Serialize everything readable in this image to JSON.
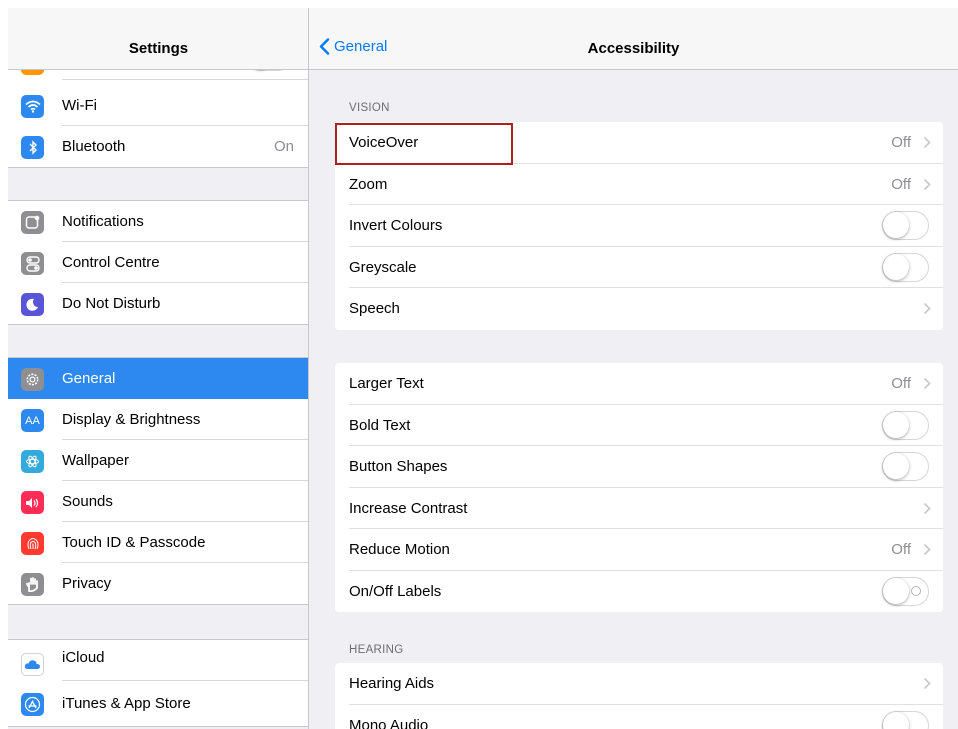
{
  "left_pane": {
    "title": "Settings",
    "groups": [
      {
        "items": [
          {
            "label": "Wi-Fi",
            "icon": "wifi-icon",
            "color": "#2d89ef"
          },
          {
            "label": "Bluetooth",
            "icon": "bluetooth-icon",
            "color": "#2d89ef",
            "value": "On"
          }
        ]
      },
      {
        "items": [
          {
            "label": "Notifications",
            "icon": "notifications-icon",
            "color": "#8e8e93"
          },
          {
            "label": "Control Centre",
            "icon": "control-centre-icon",
            "color": "#8e8e93"
          },
          {
            "label": "Do Not Disturb",
            "icon": "moon-icon",
            "color": "#5856d6"
          }
        ]
      },
      {
        "items": [
          {
            "label": "General",
            "icon": "gear-icon",
            "color": "#8e8e93",
            "selected": true
          },
          {
            "label": "Display & Brightness",
            "icon": "display-icon",
            "color": "#2d89ef",
            "glyph": "AA"
          },
          {
            "label": "Wallpaper",
            "icon": "wallpaper-icon",
            "color": "#34aadc"
          },
          {
            "label": "Sounds",
            "icon": "sounds-icon",
            "color": "#ff2d55"
          },
          {
            "label": "Touch ID & Passcode",
            "icon": "fingerprint-icon",
            "color": "#ff3b30"
          },
          {
            "label": "Privacy",
            "icon": "hand-icon",
            "color": "#8e8e93"
          }
        ]
      },
      {
        "items": [
          {
            "label": "iCloud",
            "icon": "cloud-icon",
            "color": "#ffffff"
          },
          {
            "label": "iTunes & App Store",
            "icon": "app-store-icon",
            "color": "#2d89ef"
          }
        ]
      }
    ]
  },
  "right_pane": {
    "back_label": "General",
    "title": "Accessibility",
    "sections": [
      {
        "header": "VISION",
        "rows": [
          {
            "label": "VoiceOver",
            "value": "Off",
            "type": "disclosure"
          },
          {
            "label": "Zoom",
            "value": "Off",
            "type": "disclosure"
          },
          {
            "label": "Invert Colours",
            "type": "toggle"
          },
          {
            "label": "Greyscale",
            "type": "toggle"
          },
          {
            "label": "Speech",
            "type": "disclosure"
          }
        ]
      },
      {
        "header": "",
        "rows": [
          {
            "label": "Larger Text",
            "value": "Off",
            "type": "disclosure"
          },
          {
            "label": "Bold Text",
            "type": "toggle"
          },
          {
            "label": "Button Shapes",
            "type": "toggle"
          },
          {
            "label": "Increase Contrast",
            "type": "disclosure"
          },
          {
            "label": "Reduce Motion",
            "value": "Off",
            "type": "disclosure"
          },
          {
            "label": "On/Off Labels",
            "type": "toggle-onoff"
          }
        ]
      },
      {
        "header": "HEARING",
        "rows": [
          {
            "label": "Hearing Aids",
            "type": "disclosure"
          },
          {
            "label": "Mono Audio",
            "type": "toggle"
          }
        ]
      }
    ]
  },
  "colors": {
    "accent": "#007aff",
    "selected": "#2d89ef",
    "highlight_border": "#a8231f"
  }
}
